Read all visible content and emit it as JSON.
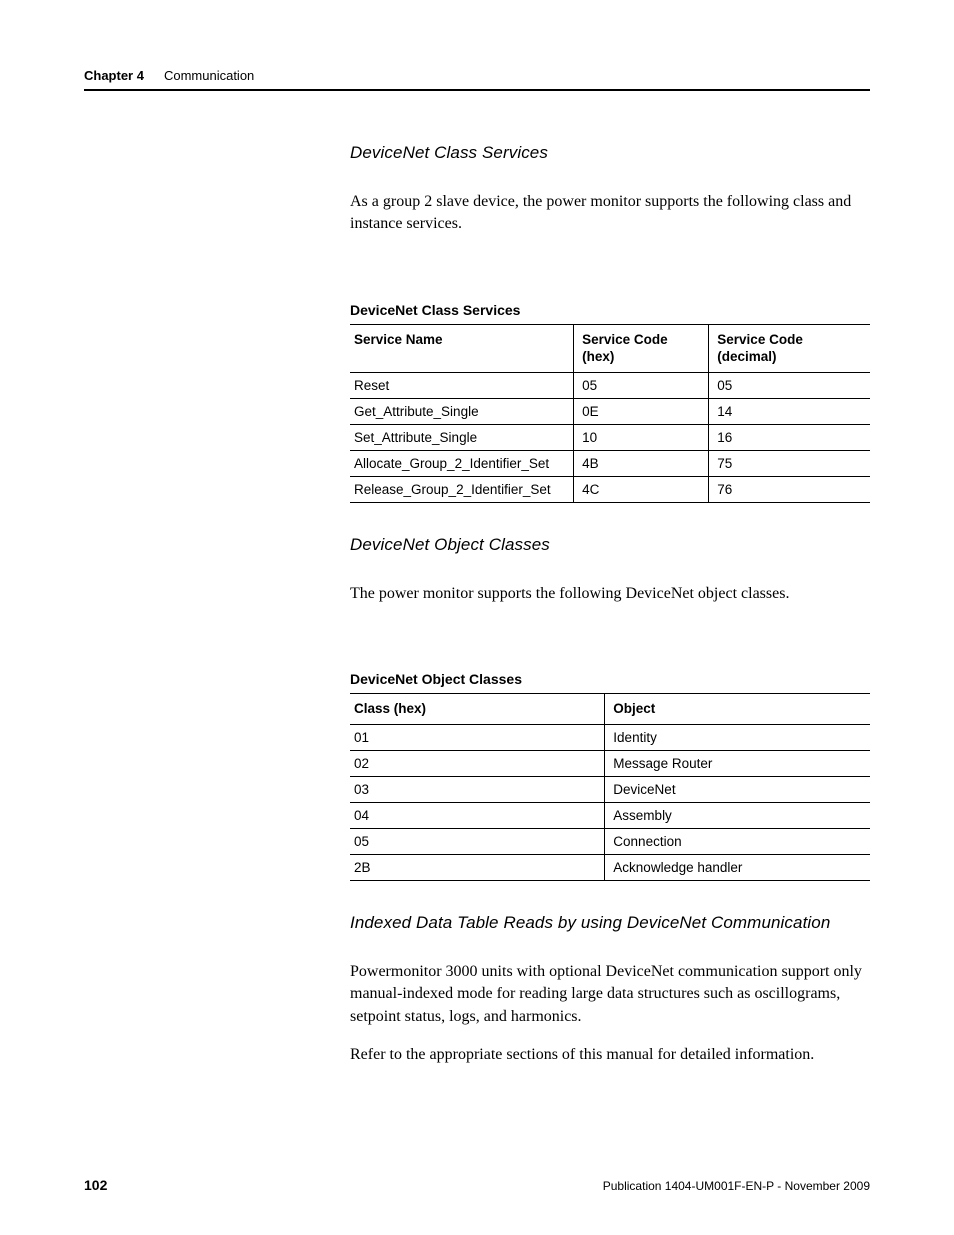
{
  "header": {
    "chapter": "Chapter 4",
    "title": "Communication"
  },
  "sections": {
    "s1": {
      "heading": "DeviceNet Class Services",
      "para": "As a group 2 slave device, the power monitor supports the following class and instance services."
    },
    "s2": {
      "heading": "DeviceNet Object Classes",
      "para": "The power monitor supports the following DeviceNet object classes."
    },
    "s3": {
      "heading": "Indexed Data Table Reads by using DeviceNet Communication",
      "para1": "Powermonitor 3000 units with optional DeviceNet communication support only manual-indexed mode for reading large data structures such as oscillograms, setpoint status, logs, and harmonics.",
      "para2": "Refer to the appropriate sections of this manual for detailed information."
    }
  },
  "table1": {
    "title": "DeviceNet Class Services",
    "headers": [
      "Service Name",
      "Service Code (hex)",
      "Service Code (decimal)"
    ],
    "rows": [
      [
        "Reset",
        "05",
        "05"
      ],
      [
        "Get_Attribute_Single",
        "0E",
        "14"
      ],
      [
        "Set_Attribute_Single",
        "10",
        "16"
      ],
      [
        "Allocate_Group_2_Identifier_Set",
        "4B",
        "75"
      ],
      [
        "Release_Group_2_Identifier_Set",
        "4C",
        "76"
      ]
    ]
  },
  "table2": {
    "title": "DeviceNet Object Classes",
    "headers": [
      "Class (hex)",
      "Object"
    ],
    "rows": [
      [
        "01",
        "Identity"
      ],
      [
        "02",
        "Message Router"
      ],
      [
        "03",
        "DeviceNet"
      ],
      [
        "04",
        "Assembly"
      ],
      [
        "05",
        "Connection"
      ],
      [
        "2B",
        "Acknowledge handler"
      ]
    ]
  },
  "footer": {
    "page": "102",
    "publication": "Publication 1404-UM001F-EN-P - November 2009"
  }
}
